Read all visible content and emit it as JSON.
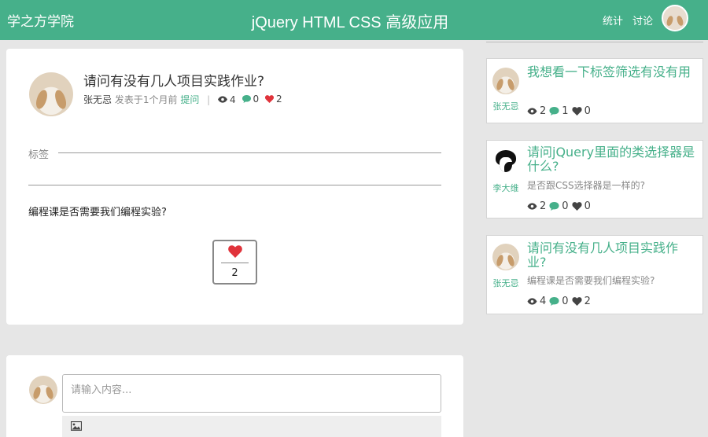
{
  "header": {
    "brand": "学之方学院",
    "course_title": "jQuery HTML CSS 高级应用",
    "nav": {
      "stats": "统计",
      "discuss": "讨论"
    },
    "user_avatar_icon": "rabbit-avatar"
  },
  "question": {
    "title": "请问有没有几人项目实践作业?",
    "author": "张无忌",
    "posted_time": "发表于1个月前",
    "type_tag": "提问",
    "views": "4",
    "comments": "0",
    "likes": "2",
    "tags_label": "标签",
    "body": "编程课是否需要我们编程实验?",
    "like_count": "2"
  },
  "reply": {
    "placeholder": "请输入内容...",
    "image_icon": "image-icon"
  },
  "sidebar": {
    "items": [
      {
        "author": "张无忌",
        "avatar": "rabbit-avatar",
        "title": "我想看一下标签筛选有没有用",
        "desc": "",
        "views": "2",
        "comments": "1",
        "likes": "0"
      },
      {
        "author": "李大维",
        "avatar": "che-avatar",
        "title": "请问jQuery里面的类选择器是什么?",
        "desc": "是否跟CSS选择器是一样的?",
        "views": "2",
        "comments": "0",
        "likes": "0"
      },
      {
        "author": "张无忌",
        "avatar": "rabbit-avatar",
        "title": "请问有没有几人项目实践作业?",
        "desc": "编程课是否需要我们编程实验?",
        "views": "4",
        "comments": "0",
        "likes": "2"
      }
    ]
  },
  "colors": {
    "accent": "#46b08a",
    "heart": "#e0333b",
    "background": "#e6e6e6"
  }
}
